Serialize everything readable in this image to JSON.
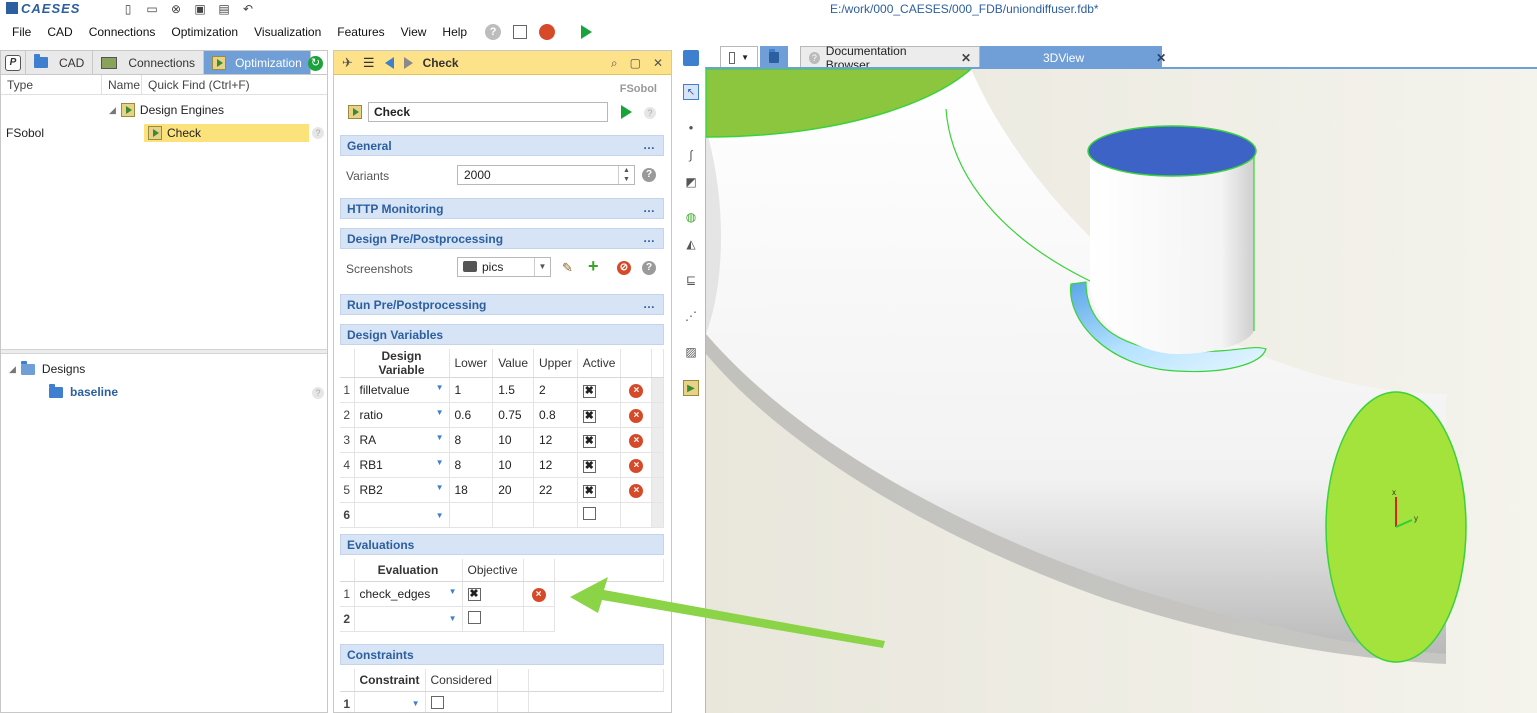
{
  "app": {
    "logo": "CAESES",
    "window_title": "E:/work/000_CAESES/000_FDB/uniondiffuser.fdb*"
  },
  "menu": [
    "File",
    "CAD",
    "Connections",
    "Optimization",
    "Visualization",
    "Features",
    "View",
    "Help"
  ],
  "left_panel": {
    "tabs": [
      {
        "label": "P"
      },
      {
        "label": "CAD"
      },
      {
        "label": "Connections"
      },
      {
        "label": "Optimization"
      }
    ],
    "columns": [
      "Type",
      "Name",
      "Quick Find (Ctrl+F)"
    ],
    "tree": {
      "group": "Design Engines",
      "item_type": "FSobol",
      "item_name": "Check"
    },
    "designs": {
      "root": "Designs",
      "child": "baseline"
    }
  },
  "engine": {
    "header_title": "Check",
    "type_label": "FSobol",
    "name": "Check",
    "sections": {
      "general": "General",
      "http": "HTTP Monitoring",
      "design_pre": "Design Pre/Postprocessing",
      "run_pre": "Run Pre/Postprocessing",
      "design_vars": "Design Variables",
      "evaluations": "Evaluations",
      "constraints": "Constraints"
    },
    "variants_label": "Variants",
    "variants_value": "2000",
    "screenshots_label": "Screenshots",
    "screenshots_value": "pics",
    "dv_headers": [
      "Design Variable",
      "Lower",
      "Value",
      "Upper",
      "Active"
    ],
    "design_variables": [
      {
        "n": "1",
        "name": "filletvalue",
        "lower": "1",
        "value": "1.5",
        "upper": "2"
      },
      {
        "n": "2",
        "name": "ratio",
        "lower": "0.6",
        "value": "0.75",
        "upper": "0.8"
      },
      {
        "n": "3",
        "name": "RA",
        "lower": "8",
        "value": "10",
        "upper": "12"
      },
      {
        "n": "4",
        "name": "RB1",
        "lower": "8",
        "value": "10",
        "upper": "12"
      },
      {
        "n": "5",
        "name": "RB2",
        "lower": "18",
        "value": "20",
        "upper": "22"
      }
    ],
    "dv_empty_row": "6",
    "eval_headers": [
      "Evaluation",
      "Objective"
    ],
    "evaluations": [
      {
        "n": "1",
        "name": "check_edges"
      }
    ],
    "eval_empty_row": "2",
    "constraint_headers": [
      "Constraint",
      "Considered"
    ],
    "constraint_empty_row": "1"
  },
  "view_tabs": {
    "doc": "Documentation Browser",
    "view3d": "3DView"
  },
  "axis": {
    "x": "x",
    "y": "y"
  },
  "colors": {
    "accent_blue": "#6f9fd6",
    "header_yellow": "#fde28a",
    "section_blue": "#d6e4f5",
    "face_green": "#a3e33b",
    "face_blue": "#3d63c7",
    "arrow_green": "#8bd447"
  }
}
